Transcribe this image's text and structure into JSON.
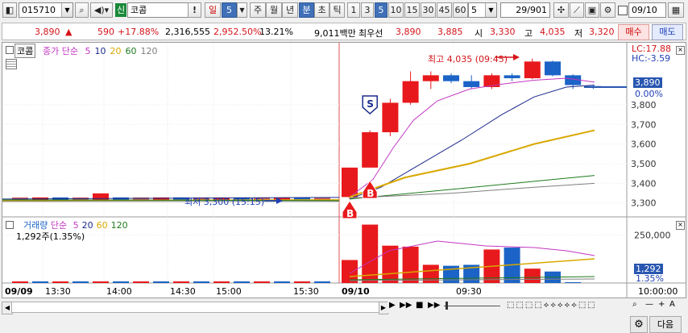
{
  "toolbar": {
    "code": "015710",
    "badge": "신",
    "name": "코콤",
    "exclaim": "!",
    "period_day": "일",
    "period_day_n": "5",
    "period_week": "주",
    "period_month": "월",
    "period_year": "년",
    "period_min": "분",
    "period_tick": "초",
    "period_sec": "틱",
    "intervals": [
      "1",
      "3",
      "5",
      "10",
      "15",
      "30",
      "45",
      "60"
    ],
    "selected_interval": "5",
    "count_value": "5",
    "page_counter": "29/901",
    "date_value": "09/10"
  },
  "quote": {
    "price": "3,890",
    "change_arrow": "▲",
    "change": "590",
    "change_pct": "+17.88%",
    "volume": "2,316,555",
    "volume_ratio": "2,952.50%",
    "turnover": "13.21%",
    "amount": "9,011백만",
    "priority_label": "최우선",
    "ask": "3,890",
    "bid": "3,885",
    "open_label": "시",
    "open": "3,330",
    "high_label": "고",
    "high": "4,035",
    "low_label": "저",
    "low": "3,320",
    "buy_button": "매수",
    "sell_button": "매도"
  },
  "price_panel": {
    "stock_tag": "코콤",
    "ma_label": "종가 단순",
    "ma_periods": [
      "5",
      "10",
      "20",
      "60",
      "120"
    ],
    "ma_colors": [
      "#c236c2",
      "#1b2a8c",
      "#d9a800",
      "#1e7a1e",
      "#7f7f7f"
    ],
    "lc_label": "LC:17.88",
    "hc_label": "HC:-3.59",
    "current_price_tag": "3,890",
    "pct_tag": "0.00%",
    "high_annotation": "최고 4,035 (09:45)",
    "low_annotation": "최저 3,300 (15:15)",
    "y_ticks": [
      "3,800",
      "3,700",
      "3,600",
      "3,500",
      "3,400",
      "3,300"
    ],
    "signal_buy": "B",
    "signal_sell": "S"
  },
  "volume_panel": {
    "label": "거래량",
    "ma_label": "단순",
    "ma_periods": [
      "5",
      "20",
      "60",
      "120"
    ],
    "current_text": "1,292주(1.35%)",
    "y_ticks": [
      "250,000"
    ],
    "current_tag": "1,292",
    "pct_tag": "1.35%"
  },
  "time_axis": {
    "labels": [
      "09/09",
      "13:30",
      "14:00",
      "14:30",
      "15:00",
      "15:30",
      "09/10",
      "09:30"
    ],
    "end_label": "10:00:00"
  },
  "bottom": {
    "next_button": "다음"
  },
  "colors": {
    "up": "#e8191c",
    "down": "#1b63c6",
    "accent": "#3f70b8"
  },
  "chart_data": {
    "type": "candlestick",
    "interval_minutes": 5,
    "title": "코콤",
    "xlabel": "",
    "ylabel": "",
    "ylim": [
      3270,
      4050
    ],
    "candles": [
      {
        "t": "09/10 09:00",
        "o": 3330,
        "h": 3480,
        "l": 3320,
        "c": 3480
      },
      {
        "t": "09/10 09:05",
        "o": 3480,
        "h": 3670,
        "l": 3480,
        "c": 3660
      },
      {
        "t": "09/10 09:10",
        "o": 3660,
        "h": 3830,
        "l": 3640,
        "c": 3810
      },
      {
        "t": "09/10 09:15",
        "o": 3810,
        "h": 3970,
        "l": 3800,
        "c": 3920
      },
      {
        "t": "09/10 09:20",
        "o": 3920,
        "h": 3970,
        "l": 3880,
        "c": 3950
      },
      {
        "t": "09/10 09:25",
        "o": 3950,
        "h": 3960,
        "l": 3910,
        "c": 3920
      },
      {
        "t": "09/10 09:30",
        "o": 3920,
        "h": 3950,
        "l": 3880,
        "c": 3890
      },
      {
        "t": "09/10 09:35",
        "o": 3890,
        "h": 3960,
        "l": 3880,
        "c": 3950
      },
      {
        "t": "09/10 09:40",
        "o": 3950,
        "h": 3960,
        "l": 3920,
        "c": 3935
      },
      {
        "t": "09/10 09:45",
        "o": 3935,
        "h": 4035,
        "l": 3930,
        "c": 4020
      },
      {
        "t": "09/10 09:50",
        "o": 4020,
        "h": 4025,
        "l": 3945,
        "c": 3950
      },
      {
        "t": "09/10 09:55",
        "o": 3950,
        "h": 3955,
        "l": 3880,
        "c": 3900
      },
      {
        "t": "09/10 10:00",
        "o": 3895,
        "h": 3900,
        "l": 3880,
        "c": 3890
      }
    ],
    "volume": [
      120000,
      305000,
      195000,
      190000,
      95000,
      90000,
      95000,
      175000,
      185000,
      75000,
      60000,
      1292
    ]
  }
}
